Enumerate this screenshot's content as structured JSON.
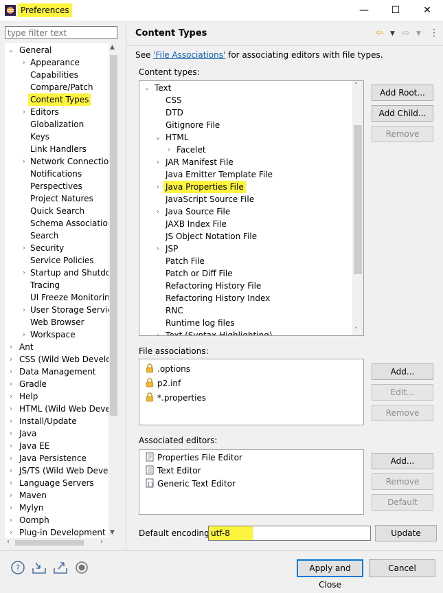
{
  "window": {
    "title": "Preferences",
    "minimize": "—",
    "maximize": "☐",
    "close": "✕",
    "highlight_color": "#fdf43f"
  },
  "filter": {
    "placeholder": "type filter text"
  },
  "tree": [
    {
      "label": "General",
      "level": 0,
      "expanded": true
    },
    {
      "label": "Appearance",
      "level": 1,
      "arrow": true
    },
    {
      "label": "Capabilities",
      "level": 1
    },
    {
      "label": "Compare/Patch",
      "level": 1
    },
    {
      "label": "Content Types",
      "level": 1,
      "selected": true
    },
    {
      "label": "Editors",
      "level": 1,
      "arrow": true
    },
    {
      "label": "Globalization",
      "level": 1
    },
    {
      "label": "Keys",
      "level": 1
    },
    {
      "label": "Link Handlers",
      "level": 1
    },
    {
      "label": "Network Connection",
      "level": 1,
      "arrow": true
    },
    {
      "label": "Notifications",
      "level": 1
    },
    {
      "label": "Perspectives",
      "level": 1
    },
    {
      "label": "Project Natures",
      "level": 1
    },
    {
      "label": "Quick Search",
      "level": 1
    },
    {
      "label": "Schema Associations",
      "level": 1
    },
    {
      "label": "Search",
      "level": 1
    },
    {
      "label": "Security",
      "level": 1,
      "arrow": true
    },
    {
      "label": "Service Policies",
      "level": 1
    },
    {
      "label": "Startup and Shutdow",
      "level": 1,
      "arrow": true
    },
    {
      "label": "Tracing",
      "level": 1
    },
    {
      "label": "UI Freeze Monitoring",
      "level": 1
    },
    {
      "label": "User Storage Service",
      "level": 1,
      "arrow": true
    },
    {
      "label": "Web Browser",
      "level": 1
    },
    {
      "label": "Workspace",
      "level": 1,
      "arrow": true
    },
    {
      "label": "Ant",
      "level": 0,
      "arrow": true
    },
    {
      "label": "CSS (Wild Web Develop",
      "level": 0,
      "arrow": true
    },
    {
      "label": "Data Management",
      "level": 0,
      "arrow": true
    },
    {
      "label": "Gradle",
      "level": 0,
      "arrow": true
    },
    {
      "label": "Help",
      "level": 0,
      "arrow": true
    },
    {
      "label": "HTML (Wild Web Develo",
      "level": 0,
      "arrow": true
    },
    {
      "label": "Install/Update",
      "level": 0,
      "arrow": true
    },
    {
      "label": "Java",
      "level": 0,
      "arrow": true
    },
    {
      "label": "Java EE",
      "level": 0,
      "arrow": true
    },
    {
      "label": "Java Persistence",
      "level": 0,
      "arrow": true
    },
    {
      "label": "JS/TS (Wild Web Develo",
      "level": 0,
      "arrow": true
    },
    {
      "label": "Language Servers",
      "level": 0,
      "arrow": true
    },
    {
      "label": "Maven",
      "level": 0,
      "arrow": true
    },
    {
      "label": "Mylyn",
      "level": 0,
      "arrow": true
    },
    {
      "label": "Oomph",
      "level": 0,
      "arrow": true
    },
    {
      "label": "Plug-in Development",
      "level": 0,
      "arrow": true
    }
  ],
  "page": {
    "title": "Content Types",
    "see_prefix": "See ",
    "see_link": "'File Associations'",
    "see_suffix": " for associating editors with file types."
  },
  "content_types": {
    "label": "Content types:",
    "items": [
      {
        "label": "Text",
        "level": 0,
        "expanded": true
      },
      {
        "label": "CSS",
        "level": 1
      },
      {
        "label": "DTD",
        "level": 1
      },
      {
        "label": "Gitignore File",
        "level": 1
      },
      {
        "label": "HTML",
        "level": 1,
        "expanded": true
      },
      {
        "label": "Facelet",
        "level": 2,
        "arrow": true
      },
      {
        "label": "JAR Manifest File",
        "level": 1,
        "arrow": true
      },
      {
        "label": "Java Emitter Template File",
        "level": 1
      },
      {
        "label": "Java Properties File",
        "level": 1,
        "arrow": true,
        "highlighted": true
      },
      {
        "label": "JavaScript Source File",
        "level": 1
      },
      {
        "label": "Java Source File",
        "level": 1,
        "arrow": true
      },
      {
        "label": "JAXB Index File",
        "level": 1
      },
      {
        "label": "JS Object Notation File",
        "level": 1
      },
      {
        "label": "JSP",
        "level": 1,
        "arrow": true
      },
      {
        "label": "Patch File",
        "level": 1
      },
      {
        "label": "Patch or Diff File",
        "level": 1
      },
      {
        "label": "Refactoring History File",
        "level": 1
      },
      {
        "label": "Refactoring History Index",
        "level": 1
      },
      {
        "label": "RNC",
        "level": 1
      },
      {
        "label": "Runtime log files",
        "level": 1
      },
      {
        "label": "Text (Syntax Highlighting)",
        "level": 1,
        "arrow": true
      }
    ],
    "buttons": {
      "add_root": "Add Root...",
      "add_child": "Add Child...",
      "remove": "Remove"
    }
  },
  "file_associations": {
    "label": "File associations:",
    "items": [
      ".options",
      "p2.inf",
      "*.properties"
    ],
    "buttons": {
      "add": "Add...",
      "edit": "Edit...",
      "remove": "Remove"
    }
  },
  "associated_editors": {
    "label": "Associated editors:",
    "items": [
      "Properties File Editor",
      "Text Editor",
      "Generic Text Editor"
    ],
    "buttons": {
      "add": "Add...",
      "remove": "Remove",
      "default": "Default"
    }
  },
  "encoding": {
    "label": "Default encoding:",
    "value": "utf-8",
    "update": "Update"
  },
  "footer": {
    "apply_close": "Apply and Close",
    "cancel": "Cancel"
  }
}
